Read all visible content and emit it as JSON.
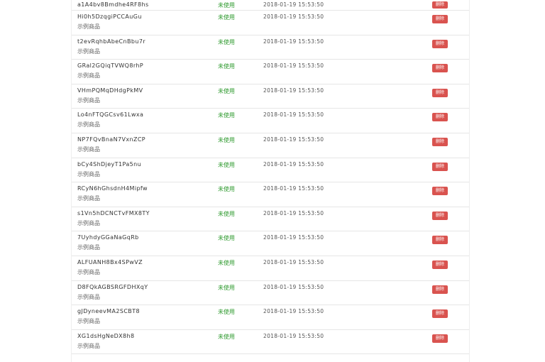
{
  "rows": [
    {
      "code": "a1A4bv8Bmdhe4RF8hs",
      "name": "",
      "status": "未使用",
      "time": "2018-01-19 15:53:50",
      "action": "删除"
    },
    {
      "code": "Hi0h5DzqgiPCCAuGu",
      "name": "示例商品",
      "status": "未使用",
      "time": "2018-01-19 15:53:50",
      "action": "删除"
    },
    {
      "code": "t2evRqhbAbeCnBbu7r",
      "name": "示例商品",
      "status": "未使用",
      "time": "2018-01-19 15:53:50",
      "action": "删除"
    },
    {
      "code": "GRal2GQiqTVWQ8rhP",
      "name": "示例商品",
      "status": "未使用",
      "time": "2018-01-19 15:53:50",
      "action": "删除"
    },
    {
      "code": "VHmPQMqDHdgPkMV",
      "name": "示例商品",
      "status": "未使用",
      "time": "2018-01-19 15:53:50",
      "action": "删除"
    },
    {
      "code": "Lo4nFTQGCsv61Lwxa",
      "name": "示例商品",
      "status": "未使用",
      "time": "2018-01-19 15:53:50",
      "action": "删除"
    },
    {
      "code": "NP7FQvBnaN7VxnZCP",
      "name": "示例商品",
      "status": "未使用",
      "time": "2018-01-19 15:53:50",
      "action": "删除"
    },
    {
      "code": "bCy4ShDjeyT1Pa5nu",
      "name": "示例商品",
      "status": "未使用",
      "time": "2018-01-19 15:53:50",
      "action": "删除"
    },
    {
      "code": "RCyN6hGhsdnH4Mipfw",
      "name": "示例商品",
      "status": "未使用",
      "time": "2018-01-19 15:53:50",
      "action": "删除"
    },
    {
      "code": "s1Vn5hDCNCTvFMX8TY",
      "name": "示例商品",
      "status": "未使用",
      "time": "2018-01-19 15:53:50",
      "action": "删除"
    },
    {
      "code": "7UyhdyGGaNaGqRb",
      "name": "示例商品",
      "status": "未使用",
      "time": "2018-01-19 15:53:50",
      "action": "删除"
    },
    {
      "code": "ALFUANH8Bx4SPwVZ",
      "name": "示例商品",
      "status": "未使用",
      "time": "2018-01-19 15:53:50",
      "action": "删除"
    },
    {
      "code": "D8FQkAGBSRGFDHXqY",
      "name": "示例商品",
      "status": "未使用",
      "time": "2018-01-19 15:53:50",
      "action": "删除"
    },
    {
      "code": "gJDyneevMA2SCBT8",
      "name": "示例商品",
      "status": "未使用",
      "time": "2018-01-19 15:53:50",
      "action": "删除"
    },
    {
      "code": "XG1dsHgNeDX8h8",
      "name": "示例商品",
      "status": "未使用",
      "time": "2018-01-19 15:53:50",
      "action": "删除"
    }
  ]
}
